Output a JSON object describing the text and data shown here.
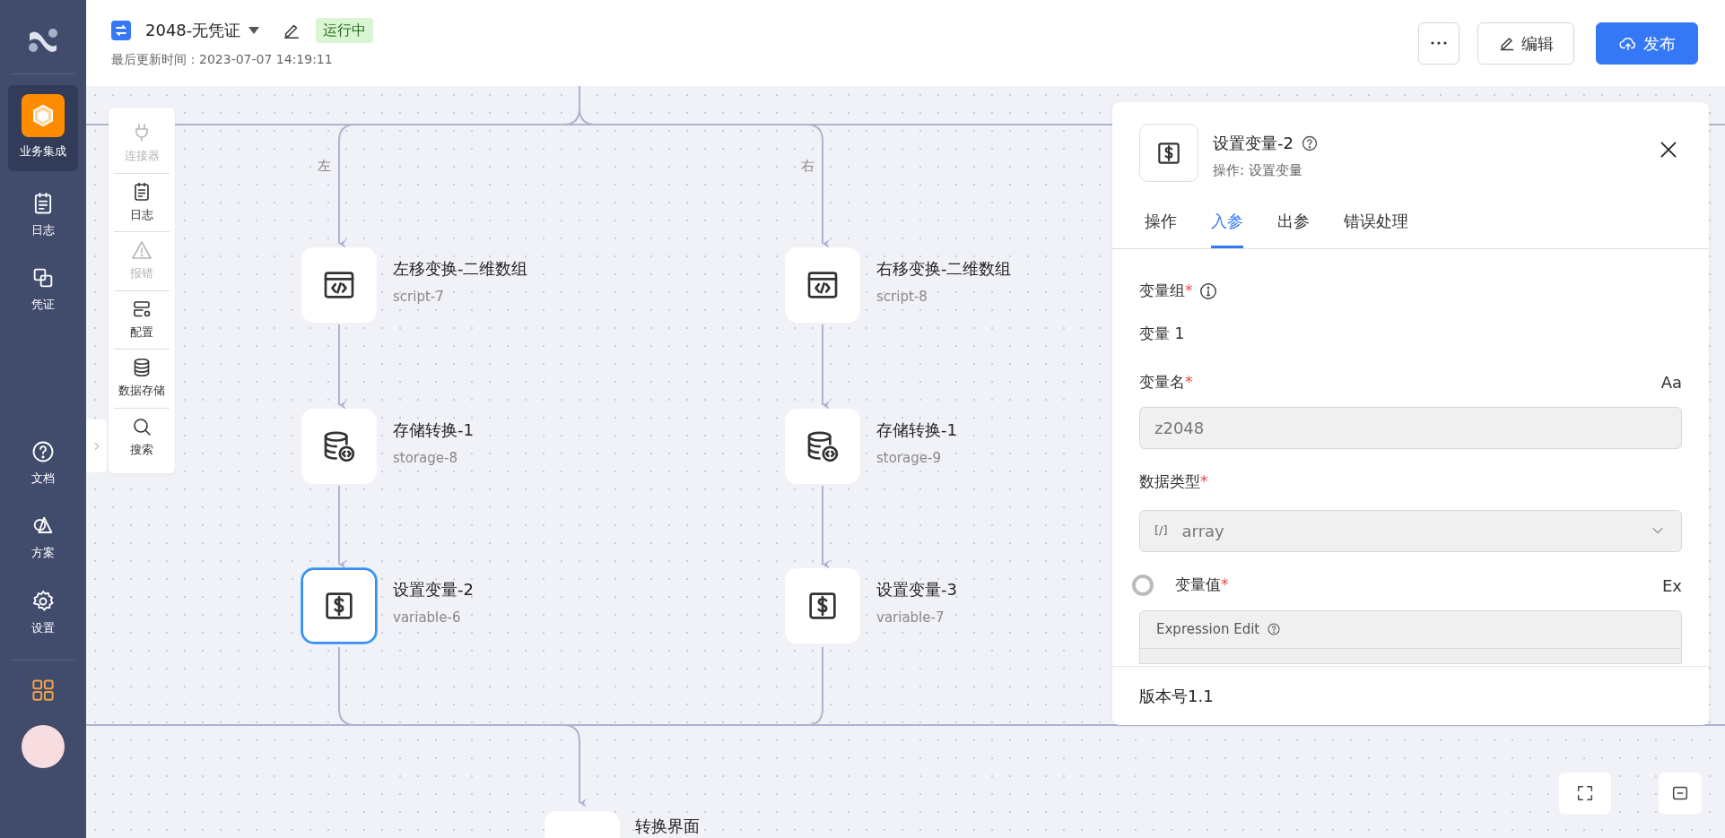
{
  "sidebar": {
    "main": [
      {
        "label": "业务集成",
        "selected": true
      },
      {
        "label": "日志",
        "selected": false
      },
      {
        "label": "凭证",
        "selected": false
      }
    ],
    "help": [
      {
        "label": "文档",
        "selected": false
      },
      {
        "label": "方案",
        "selected": false
      },
      {
        "label": "设置",
        "selected": false
      }
    ]
  },
  "header": {
    "title": "2048-无凭证",
    "status": "运行中",
    "updated": "最后更新时间：2023-07-07 14:19:11",
    "buttons": [
      {
        "kind": "more"
      },
      {
        "kind": "edit",
        "label": "编辑"
      },
      {
        "kind": "publish",
        "label": "发布"
      }
    ]
  },
  "toolbar": {
    "items": [
      {
        "label": "连接器",
        "disabled": true
      },
      {
        "label": "日志",
        "disabled": false
      },
      {
        "label": "报错",
        "disabled": true
      },
      {
        "label": "配置",
        "disabled": false
      },
      {
        "label": "数据存储",
        "disabled": false
      },
      {
        "label": "搜索",
        "disabled": false
      }
    ]
  },
  "canvas": {
    "branches": [
      "左",
      "右"
    ],
    "nodes": [
      {
        "kind": "script",
        "title": "左移变换-二维数组",
        "subtitle": "script-7",
        "selected": false
      },
      {
        "kind": "script",
        "title": "右移变换-二维数组",
        "subtitle": "script-8",
        "selected": false
      },
      {
        "kind": "storage",
        "title": "存储转换-1",
        "subtitle": "storage-8",
        "selected": false
      },
      {
        "kind": "storage",
        "title": "存储转换-1",
        "subtitle": "storage-9",
        "selected": false
      },
      {
        "kind": "variable",
        "title": "设置变量-2",
        "subtitle": "variable-6",
        "selected": true
      },
      {
        "kind": "variable",
        "title": "设置变量-3",
        "subtitle": "variable-7",
        "selected": false
      }
    ],
    "bottom_node": {
      "title": "转换界面"
    }
  },
  "panel": {
    "title": "设置变量-2",
    "subtitle": "操作: 设置变量",
    "tabs": [
      {
        "label": "操作",
        "selected": false
      },
      {
        "label": "入参",
        "selected": true
      },
      {
        "label": "出参",
        "selected": false
      },
      {
        "label": "错误处理",
        "selected": false
      }
    ],
    "group": {
      "label": "变量组",
      "required_mark": "*",
      "item": "变量 1"
    },
    "name_field": {
      "label": "变量名",
      "required_mark": "*",
      "hint": "Aa",
      "value": "z2048"
    },
    "type_field": {
      "label": "数据类型",
      "required_mark": "*",
      "prefix": "[/]",
      "value": "array"
    },
    "value_field": {
      "label": "变量值",
      "required_mark": "*",
      "checked": false,
      "hint": "Ex",
      "editor_title": "Expression Edit"
    },
    "footer": "版本号1.1"
  }
}
